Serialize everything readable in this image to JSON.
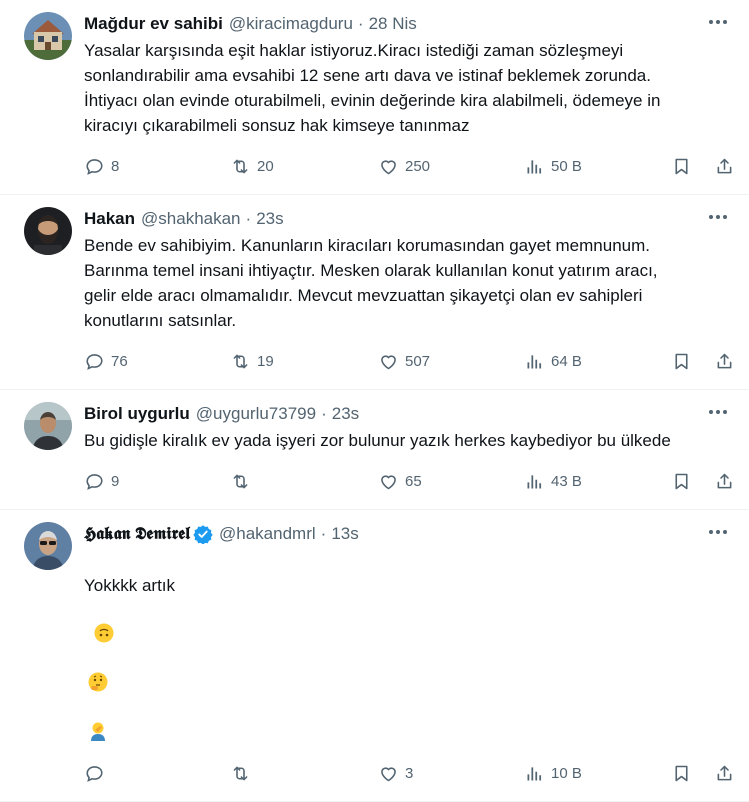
{
  "tweets": [
    {
      "name": "Mağdur ev sahibi",
      "handle": "@kiracimagduru",
      "sep": "·",
      "time": "28 Nis",
      "text": "Yasalar karşısında eşit haklar istiyoruz.Kiracı istediği zaman sözleşmeyi sonlandırabilir ama evsahibi 12 sene artı dava ve istinaf beklemek zorunda. İhtiyacı olan evinde oturabilmeli, evinin değerinde kira alabilmeli, ödemeye in kiracıyı çıkarabilmeli sonsuz hak kimseye tanınmaz",
      "replies": "8",
      "retweets": "20",
      "likes": "250",
      "views": "50 B",
      "avatar": "house-photo"
    },
    {
      "name": "Hakan",
      "handle": "@shakhakan",
      "sep": "·",
      "time": "23s",
      "text": "Bende ev sahibiyim. Kanunların kiracıları korumasından gayet memnunum. Barınma temel insani ihtiyaçtır. Mesken olarak kullanılan konut yatırım aracı, gelir elde aracı olmamalıdır. Mevcut mevzuattan şikayetçi olan ev sahipleri konutlarını satsınlar.",
      "replies": "76",
      "retweets": "19",
      "likes": "507",
      "views": "64 B",
      "avatar": "bearded-man"
    },
    {
      "name": "Birol uygurlu",
      "handle": "@uygurlu73799",
      "sep": "·",
      "time": "23s",
      "text": "Bu gidişle kiralık ev yada işyeri zor bulunur yazık herkes kaybediyor bu ülkede",
      "replies": "9",
      "retweets": "",
      "likes": "65",
      "views": "43 B",
      "avatar": "man-outdoor"
    },
    {
      "name": "𝕳𝖆𝖐𝖆𝖓 𝕯𝖊𝖒𝖎𝖗𝖊𝖑",
      "handle": "@hakandmrl",
      "sep": "·",
      "time": "13s",
      "text": "Yokkkk artık",
      "emojis": [
        "upside-down-face",
        "thinking-face",
        "man-facepalming"
      ],
      "replies": "",
      "retweets": "",
      "likes": "3",
      "views": "10 B",
      "verified": true,
      "avatar": "man-sunglasses"
    }
  ],
  "icons": {
    "reply": "reply-icon",
    "retweet": "retweet-icon",
    "like": "heart-icon",
    "views": "views-icon",
    "bookmark": "bookmark-icon",
    "share": "share-icon",
    "more": "more-icon"
  },
  "colors": {
    "text": "#0f1419",
    "secondary": "#536471",
    "verified": "#1d9bf0",
    "divider": "#eff3f4"
  }
}
